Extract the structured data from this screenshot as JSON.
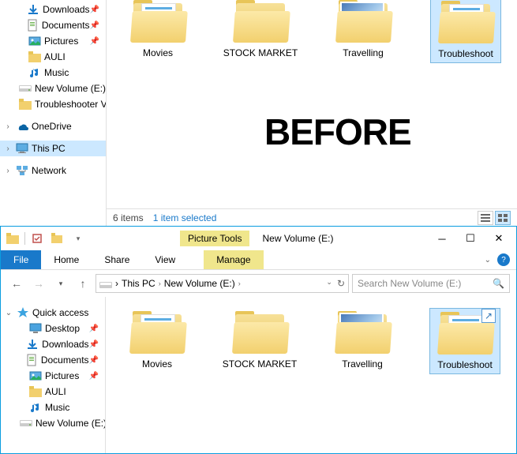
{
  "top": {
    "tree": [
      {
        "icon": "download",
        "label": "Downloads",
        "pin": true,
        "indent": 1
      },
      {
        "icon": "document",
        "label": "Documents",
        "pin": true,
        "indent": 1
      },
      {
        "icon": "pictures",
        "label": "Pictures",
        "pin": true,
        "indent": 1
      },
      {
        "icon": "folder",
        "label": "AULI",
        "pin": false,
        "indent": 1
      },
      {
        "icon": "music",
        "label": "Music",
        "pin": false,
        "indent": 1
      },
      {
        "icon": "drive",
        "label": "New Volume (E:)",
        "pin": false,
        "indent": 1
      },
      {
        "icon": "folder",
        "label": "Troubleshooter V",
        "pin": false,
        "indent": 1
      },
      {
        "spacer": true
      },
      {
        "icon": "onedrive",
        "label": "OneDrive",
        "arrow": ">",
        "indent": 0
      },
      {
        "spacer": true
      },
      {
        "icon": "thispc",
        "label": "This PC",
        "arrow": ">",
        "indent": 0,
        "selected": true
      },
      {
        "spacer": true
      },
      {
        "icon": "network",
        "label": "Network",
        "arrow": ">",
        "indent": 0
      }
    ],
    "folders": [
      {
        "name": "Movies",
        "type": "docs"
      },
      {
        "name": "STOCK MARKET",
        "type": "plain"
      },
      {
        "name": "Travelling",
        "type": "photo"
      },
      {
        "name": "Troubleshoot",
        "type": "docs",
        "selected": true
      }
    ],
    "overlay": "BEFORE",
    "status": {
      "items": "6 items",
      "selected": "1 item selected"
    }
  },
  "bottom": {
    "qat": {
      "picture_tools": "Picture Tools",
      "title": "New Volume (E:)"
    },
    "ribbon": {
      "file": "File",
      "home": "Home",
      "share": "Share",
      "view": "View",
      "manage": "Manage"
    },
    "breadcrumb": [
      {
        "label": "This PC"
      },
      {
        "label": "New Volume (E:)"
      }
    ],
    "search_placeholder": "Search New Volume (E:)",
    "tree": [
      {
        "icon": "star",
        "label": "Quick access",
        "arrow": "v",
        "indent": 0
      },
      {
        "icon": "desktop",
        "label": "Desktop",
        "pin": true,
        "indent": 1
      },
      {
        "icon": "download",
        "label": "Downloads",
        "pin": true,
        "indent": 1
      },
      {
        "icon": "document",
        "label": "Documents",
        "pin": true,
        "indent": 1
      },
      {
        "icon": "pictures",
        "label": "Pictures",
        "pin": true,
        "indent": 1
      },
      {
        "icon": "folder",
        "label": "AULI",
        "pin": false,
        "indent": 1
      },
      {
        "icon": "music",
        "label": "Music",
        "pin": false,
        "indent": 1
      },
      {
        "icon": "drive",
        "label": "New Volume (E:)",
        "pin": false,
        "indent": 1
      }
    ],
    "folders": [
      {
        "name": "Movies",
        "type": "docs"
      },
      {
        "name": "STOCK MARKET",
        "type": "plain"
      },
      {
        "name": "Travelling",
        "type": "photo"
      },
      {
        "name": "Troubleshoot",
        "type": "docs",
        "selected": true,
        "shortcut": true
      }
    ]
  }
}
